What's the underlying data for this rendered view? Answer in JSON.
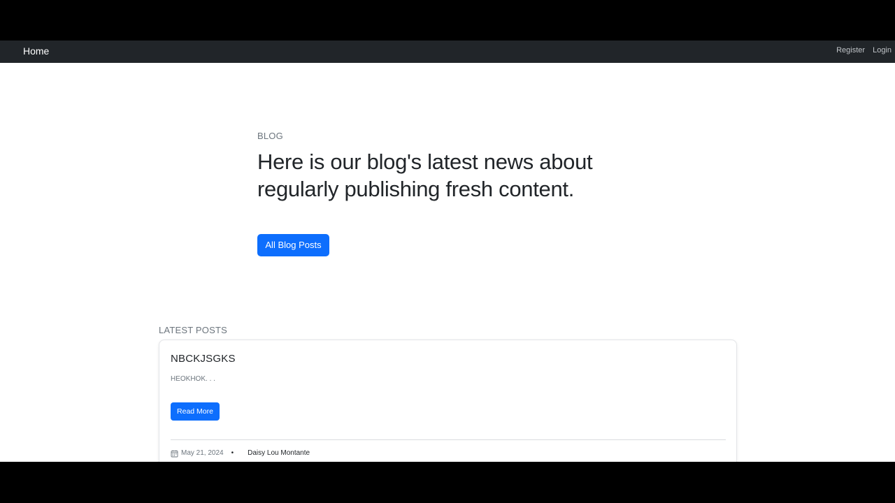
{
  "navbar": {
    "brand": "Home",
    "links": [
      "Register",
      "Login"
    ]
  },
  "hero": {
    "eyebrow": "BLOG",
    "title_line1": "Here is our blog's latest news about",
    "title_line2": "regularly publishing fresh content.",
    "button_label": "All Blog Posts"
  },
  "latest": {
    "section_label": "LATEST POSTS",
    "posts": [
      {
        "title": "NBCKJSGKS",
        "excerpt": "HEOKHOK. . .",
        "button_label": "Read More",
        "date": "May 21, 2024",
        "separator": "•",
        "author": "Daisy Lou Montante",
        "date_icon": "calendar-icon"
      }
    ]
  },
  "colors": {
    "navbar_bg": "#212529",
    "primary": "#0d6efd",
    "muted": "#6c757d"
  }
}
